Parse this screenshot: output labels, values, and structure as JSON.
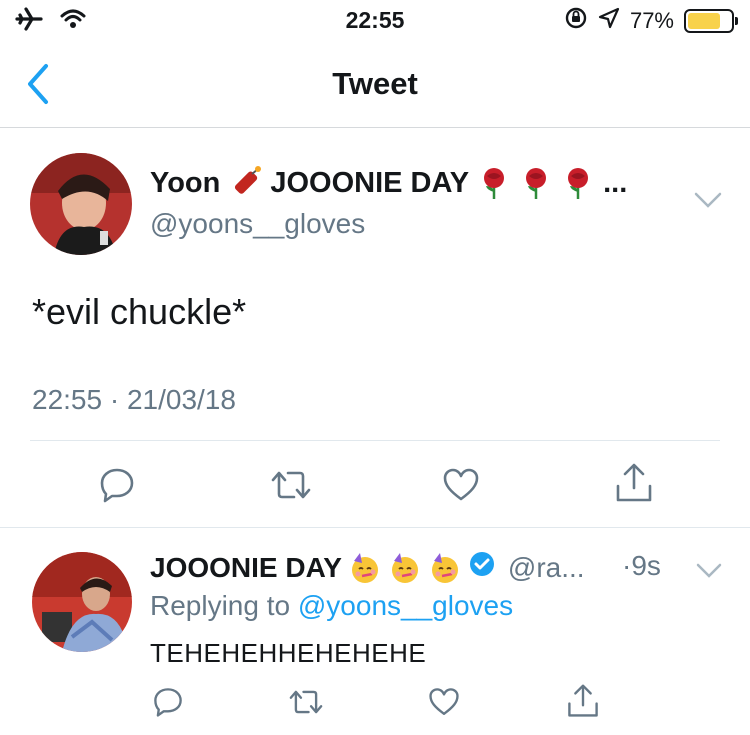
{
  "status_bar": {
    "time": "22:55",
    "battery": "77%",
    "battery_level": 0.77,
    "icons": [
      "airplane-icon",
      "wifi-icon",
      "orientation-lock-icon",
      "location-icon",
      "battery-icon"
    ]
  },
  "nav": {
    "title": "Tweet",
    "back_icon": "chevron-left-icon"
  },
  "tweet": {
    "display_name_1": "Yoon",
    "display_name_2": "JOOONIE DAY",
    "display_name_ellipsis": "...",
    "name_emojis": [
      "firecracker",
      "rose",
      "rose",
      "rose"
    ],
    "handle": "@yoons__gloves",
    "text": "*evil chuckle*",
    "timestamp": "22:55 · 21/03/18",
    "actions": [
      "reply-icon",
      "retweet-icon",
      "like-icon",
      "share-icon"
    ]
  },
  "reply": {
    "display_name": "JOOONIE DAY",
    "name_emojis": [
      "partying-face",
      "partying-face",
      "partying-face"
    ],
    "verified": true,
    "handle": "@ra...",
    "time": "·9s",
    "replying_prefix": "Replying to",
    "replying_handle": "@yoons__gloves",
    "text": "TEHEHEHHEHEHEHE",
    "actions": [
      "reply-icon",
      "retweet-icon",
      "like-icon",
      "share-icon"
    ]
  },
  "colors": {
    "accent": "#1da1f2",
    "secondary_text": "#657786",
    "battery_fill": "#f8d24b",
    "border": "#e1e8ed"
  }
}
